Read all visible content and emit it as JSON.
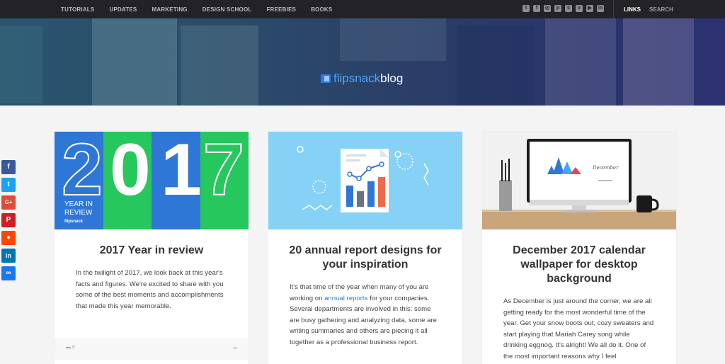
{
  "nav": {
    "items": [
      "TUTORIALS",
      "UPDATES",
      "MARKETING",
      "DESIGN SCHOOL",
      "FREEBIES",
      "BOOKS"
    ],
    "social_icons": [
      "twitter-icon",
      "facebook-icon",
      "instagram-icon",
      "pinterest-icon",
      "slideshare-icon",
      "vimeo-icon",
      "youtube-icon",
      "linkedin-icon"
    ],
    "links_label": "LINKS",
    "search_label": "SEARCH"
  },
  "hero": {
    "logo_part1": "flipsnack",
    "logo_part2": "blog"
  },
  "share": {
    "icons": [
      "facebook-icon",
      "twitter-icon",
      "google-plus-icon",
      "pinterest-icon",
      "reddit-icon",
      "linkedin-icon",
      "link-icon"
    ],
    "colors": [
      "#3b5998",
      "#1da1f2",
      "#dd4b39",
      "#cb2027",
      "#ff4500",
      "#0077b5",
      "#1877f2"
    ]
  },
  "cards": [
    {
      "image": {
        "digits": [
          "2",
          "0",
          "1",
          "7"
        ],
        "caption_line1": "YEAR IN",
        "caption_line2": "REVIEW",
        "brand": "flipsnack"
      },
      "title": "2017 Year in review",
      "text": "In the twilight of 2017, we look back at this year's facts and figures. We're excited to share with you some of the best moments and accomplishments that made this year memorable.",
      "comments": "0"
    },
    {
      "title": "20 annual report designs for your inspiration",
      "text_before": "It's that time of the year when many of you are working on ",
      "text_link": "annual reports",
      "text_after": " for your companies. Several departments are involved in this: some are busy gathering and analyzing data, some are writing summaries and others are piecing it all together as a professional business report."
    },
    {
      "image": {
        "calendar_label": "December"
      },
      "title": "December 2017 calendar wallpaper for desktop background",
      "text": "As December is just around the corner, we are all getting ready for the most wonderful time of the year. Get your snow boots out, cozy sweaters and start playing that Mariah Carey song while drinking eggnog. It's alright! We all do it. One of the most important reasons why I feel"
    }
  ],
  "colors": {
    "nav_bg": "#232327",
    "accent_blue": "#2e7ae6",
    "green": "#22c55e",
    "card_light_blue": "#7dd3fc"
  }
}
